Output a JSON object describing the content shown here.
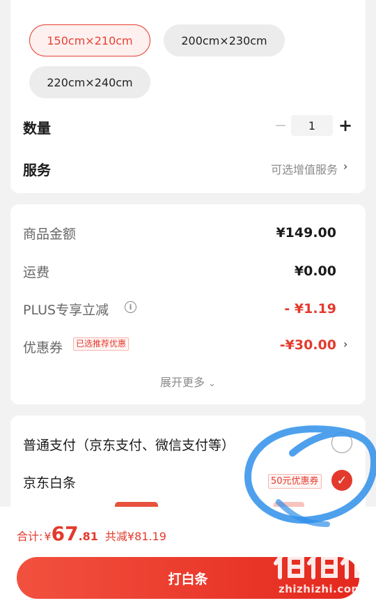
{
  "spec": {
    "options": [
      {
        "label": "150cm×210cm",
        "selected": true
      },
      {
        "label": "200cm×230cm",
        "selected": false
      },
      {
        "label": "220cm×240cm",
        "selected": false
      }
    ],
    "quantity_label": "数量",
    "quantity_value": "1",
    "minus_icon": "minus-icon",
    "plus_icon": "plus-icon",
    "service_label": "服务",
    "service_hint": "可选增值服务"
  },
  "price": {
    "goods_label": "商品金额",
    "goods_value": "¥149.00",
    "shipping_label": "运费",
    "shipping_value": "¥0.00",
    "plus_label": "PLUS专享立减",
    "plus_value": "- ¥1.19",
    "coupon_label": "优惠券",
    "coupon_tag": "已选推荐优惠",
    "coupon_value": "-¥30.00",
    "expand_label": "展开更多"
  },
  "payment": {
    "normal_label": "普通支付（京东支付、微信支付等）",
    "baitiao_label": "京东白条",
    "baitiao_coupon": "50元优惠券"
  },
  "bottom": {
    "total_label": "合计:",
    "currency": "¥",
    "total_int": "67",
    "total_dec": ".81",
    "saved": "共减¥81.19",
    "pay_button": "打白条"
  },
  "watermark": {
    "url": "zhizhizhi.com"
  },
  "colors": {
    "accent": "#e33a2d",
    "annotation_stroke": "#2f8fea"
  }
}
